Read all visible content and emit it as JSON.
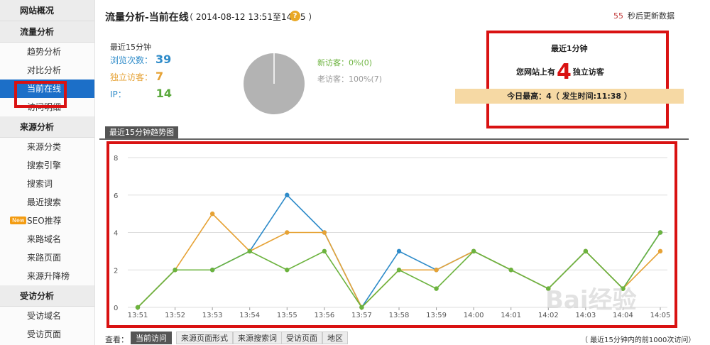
{
  "sidebar": {
    "overview": "网站概况",
    "traffic": {
      "title": "流量分析",
      "items": [
        "趋势分析",
        "对比分析",
        "当前在线",
        "访问明细"
      ]
    },
    "source": {
      "title": "来源分析",
      "items": [
        "来源分类",
        "搜索引擎",
        "搜索词",
        "最近搜索",
        "SEO推荐",
        "来路域名",
        "来路页面",
        "来源升降榜"
      ]
    },
    "visited": {
      "title": "受访分析",
      "items": [
        "受访域名",
        "受访页面"
      ]
    },
    "new_badge": "New"
  },
  "header": {
    "title": "流量分析-当前在线",
    "subtitle": "（ 2014-08-12 13:51至14:05 ）",
    "help": "?",
    "refresh_seconds": "55",
    "refresh_text": "秒后更新数据"
  },
  "stats": {
    "title": "最近15分钟",
    "pv_label": "浏览次数：",
    "pv": "39",
    "uv_label": "独立访客：",
    "uv": "7",
    "ip_label": "IP：",
    "ip": "14",
    "new_visitors": "新访客：0%(0)",
    "old_visitors": "老访客：100%(7)",
    "old_fraction": 1.0
  },
  "last_minute": {
    "title": "最近1分钟",
    "prefix": "您网站上有",
    "count": "4",
    "suffix": "独立访客",
    "peak": "今日最高：4（ 发生时间:11:38 ）"
  },
  "chart_tab": "最近15分钟趋势图",
  "chart_data": {
    "type": "line",
    "categories": [
      "13:51",
      "13:52",
      "13:53",
      "13:54",
      "13:55",
      "13:56",
      "13:57",
      "13:58",
      "13:59",
      "14:00",
      "14:01",
      "14:02",
      "14:03",
      "14:04",
      "14:05"
    ],
    "ylim": [
      0,
      8
    ],
    "yticks": [
      0,
      2,
      4,
      6,
      8
    ],
    "grid": true,
    "series": [
      {
        "color": "#2e8bc9",
        "values": [
          0,
          2,
          2,
          3,
          6,
          4,
          0,
          3,
          2,
          3,
          2,
          1,
          3,
          1,
          4
        ]
      },
      {
        "color": "#e6a235",
        "values": [
          0,
          2,
          5,
          3,
          4,
          4,
          0,
          2,
          2,
          3,
          2,
          1,
          3,
          1,
          3
        ]
      },
      {
        "color": "#6cb33e",
        "values": [
          0,
          2,
          2,
          3,
          2,
          3,
          0,
          2,
          1,
          3,
          2,
          1,
          3,
          1,
          4
        ]
      }
    ]
  },
  "view": {
    "label": "查看：",
    "tabs": [
      "当前访问",
      "来源页面形式",
      "来源搜索词",
      "受访页面",
      "地区"
    ],
    "note": "（ 最近15分钟内的前1000次访问）"
  },
  "watermark": "Bai经验"
}
